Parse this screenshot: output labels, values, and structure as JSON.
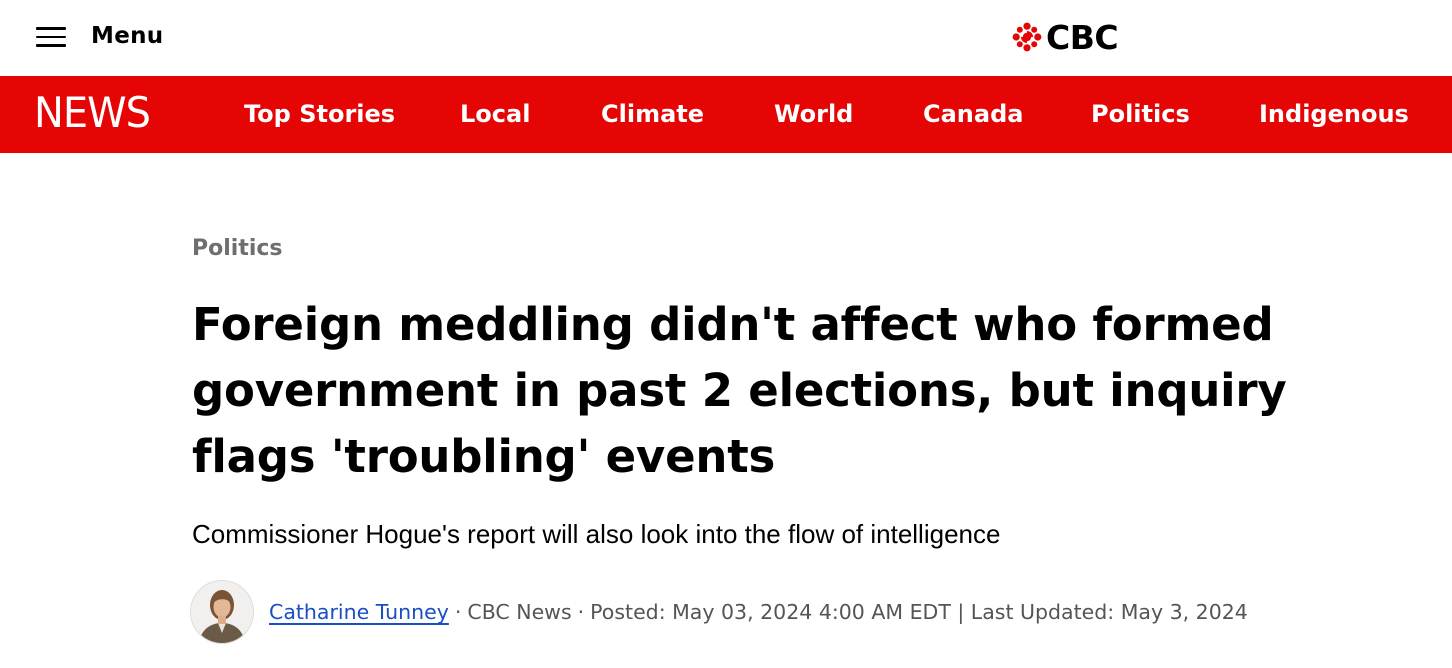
{
  "header": {
    "menu_label": "Menu",
    "logo_text": "CBC",
    "logo_color": "#e60505"
  },
  "nav": {
    "brand": "NEWS",
    "background": "#e60505",
    "items": [
      {
        "label": "Top Stories"
      },
      {
        "label": "Local"
      },
      {
        "label": "Climate"
      },
      {
        "label": "World"
      },
      {
        "label": "Canada"
      },
      {
        "label": "Politics"
      },
      {
        "label": "Indigenous"
      }
    ]
  },
  "article": {
    "section": "Politics",
    "headline": "Foreign meddling didn't affect who formed government in past 2 elections, but inquiry flags 'troubling' events",
    "deck": "Commissioner Hogue's report will also look into the flow of intelligence",
    "byline": {
      "author": "Catharine Tunney",
      "separator": "·",
      "source": "CBC News",
      "posted": "Posted: May 03, 2024 4:00 AM EDT | Last Updated: May 3, 2024"
    }
  }
}
